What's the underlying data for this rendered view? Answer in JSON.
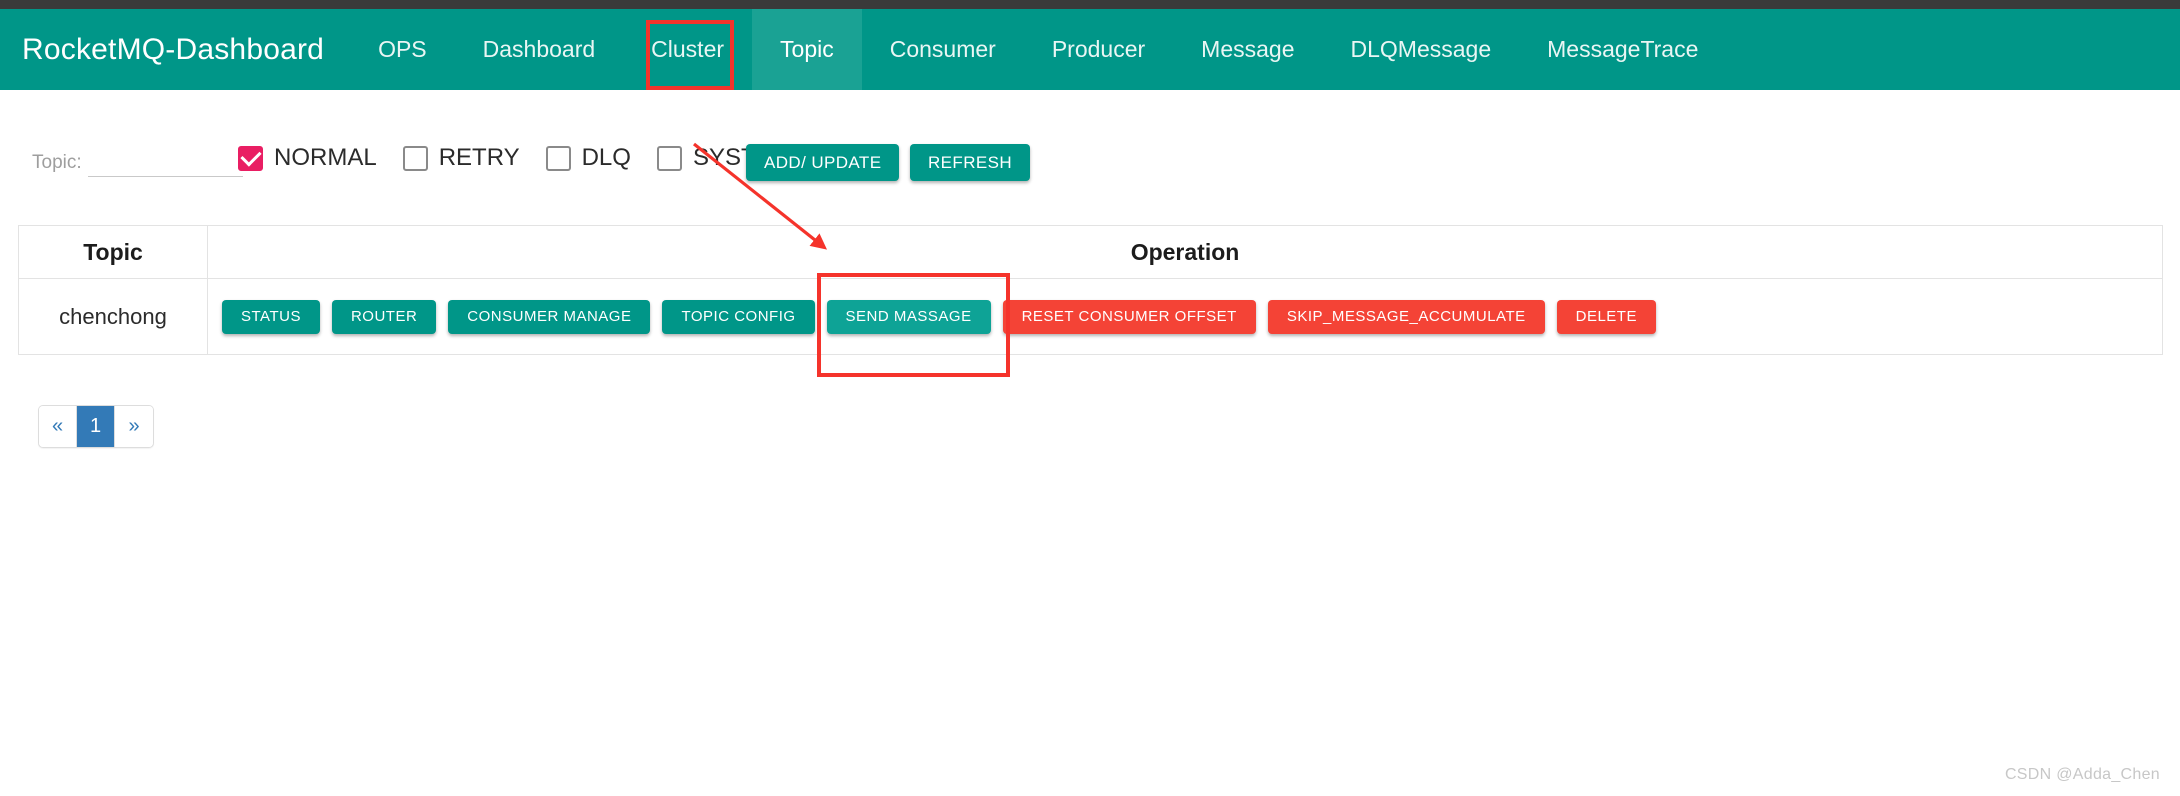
{
  "app": {
    "brand": "RocketMQ-Dashboard"
  },
  "nav": {
    "items": [
      {
        "label": "OPS",
        "active": false
      },
      {
        "label": "Dashboard",
        "active": false
      },
      {
        "label": "Cluster",
        "active": false
      },
      {
        "label": "Topic",
        "active": true
      },
      {
        "label": "Consumer",
        "active": false
      },
      {
        "label": "Producer",
        "active": false
      },
      {
        "label": "Message",
        "active": false
      },
      {
        "label": "DLQMessage",
        "active": false
      },
      {
        "label": "MessageTrace",
        "active": false
      }
    ]
  },
  "toolbar": {
    "topic_label": "Topic:",
    "topic_value": "",
    "topic_placeholder": "",
    "filters": [
      {
        "label": "NORMAL",
        "checked": true
      },
      {
        "label": "RETRY",
        "checked": false
      },
      {
        "label": "DLQ",
        "checked": false
      },
      {
        "label": "SYSTEM",
        "checked": false
      }
    ],
    "add_update_label": "ADD/ UPDATE",
    "refresh_label": "REFRESH"
  },
  "table": {
    "headers": [
      "Topic",
      "Operation"
    ],
    "rows": [
      {
        "topic": "chenchong",
        "operations": [
          {
            "label": "STATUS",
            "style": "teal"
          },
          {
            "label": "ROUTER",
            "style": "teal"
          },
          {
            "label": "CONSUMER MANAGE",
            "style": "teal"
          },
          {
            "label": "TOPIC CONFIG",
            "style": "teal"
          },
          {
            "label": "SEND MASSAGE",
            "style": "teal-highlight"
          },
          {
            "label": "RESET CONSUMER OFFSET",
            "style": "red"
          },
          {
            "label": "SKIP_MESSAGE_ACCUMULATE",
            "style": "red"
          },
          {
            "label": "DELETE",
            "style": "red"
          }
        ]
      }
    ]
  },
  "pagination": {
    "prev": "«",
    "next": "»",
    "pages": [
      "1"
    ],
    "current": "1"
  },
  "annotations": {
    "watermark": "CSDN @Adda_Chen",
    "highlight_color": "#F5332B"
  },
  "colors": {
    "brand_teal": "#009688",
    "active_tab": "#1aa294",
    "danger_red": "#F44336",
    "checkbox_pink": "#E91E63",
    "pager_blue": "#337ab7"
  }
}
